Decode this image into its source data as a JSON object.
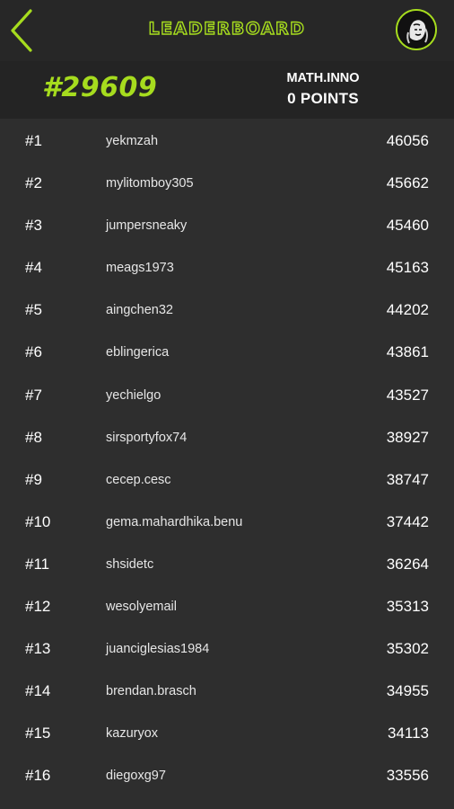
{
  "header": {
    "title": "LEADERBOARD",
    "back_icon": "chevron-left-icon",
    "avatar_icon": "user-avatar-icon",
    "accent_color": "#a6dc1e"
  },
  "me": {
    "rank": "#29609",
    "username": "MATH.INNO",
    "points": "0 POINTS"
  },
  "leaderboard": [
    {
      "rank": "#1",
      "name": "yekmzah",
      "points": "46056"
    },
    {
      "rank": "#2",
      "name": "mylitomboy305",
      "points": "45662"
    },
    {
      "rank": "#3",
      "name": "jumpersneaky",
      "points": "45460"
    },
    {
      "rank": "#4",
      "name": "meags1973",
      "points": "45163"
    },
    {
      "rank": "#5",
      "name": "aingchen32",
      "points": "44202"
    },
    {
      "rank": "#6",
      "name": "eblingerica",
      "points": "43861"
    },
    {
      "rank": "#7",
      "name": "yechielgo",
      "points": "43527"
    },
    {
      "rank": "#8",
      "name": "sirsportyfox74",
      "points": "38927"
    },
    {
      "rank": "#9",
      "name": "cecep.cesc",
      "points": "38747"
    },
    {
      "rank": "#10",
      "name": "gema.mahardhika.benu",
      "points": "37442"
    },
    {
      "rank": "#11",
      "name": "shsidetc",
      "points": "36264"
    },
    {
      "rank": "#12",
      "name": "wesolyemail",
      "points": "35313"
    },
    {
      "rank": "#13",
      "name": "juanciglesias1984",
      "points": "35302"
    },
    {
      "rank": "#14",
      "name": "brendan.brasch",
      "points": "34955"
    },
    {
      "rank": "#15",
      "name": "kazuryox",
      "points": "34113"
    },
    {
      "rank": "#16",
      "name": "diegoxg97",
      "points": "33556"
    }
  ]
}
